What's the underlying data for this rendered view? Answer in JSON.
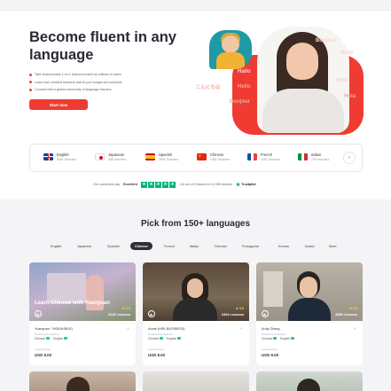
{
  "hero": {
    "title": "Become fluent in any language",
    "bullets": [
      "Take customizable 1-on-1 lessons trusted by millions of users",
      "Learn from certified teachers that fit your budget and schedule",
      "Connect with a global community of language learners"
    ],
    "cta_label": "Start now",
    "greetings": [
      "Bonjour",
      "Hello",
      "Hola",
      "Hallo",
      "Hello",
      "Hola",
      "Bonjour",
      "こんにちは"
    ]
  },
  "languages": [
    {
      "name": "English",
      "count": "9064 Teachers"
    },
    {
      "name": "Japanese",
      "count": "968 Teachers"
    },
    {
      "name": "Spanish",
      "count": "3996 Teachers"
    },
    {
      "name": "Chinese",
      "count": "1984 Teachers"
    },
    {
      "name": "French",
      "count": "1084 Teachers"
    },
    {
      "name": "Italian",
      "count": "798 Teachers"
    }
  ],
  "strip_next_label": "›",
  "trust": {
    "prefix": "Our customers say",
    "rating_word": "Excellent",
    "summary": "4.6 out of 5 based on 13,356 reviews",
    "brand": "Trustpilot"
  },
  "pick": {
    "title": "Pick from 150+ languages",
    "tabs": [
      "English",
      "Japanese",
      "Spanish",
      "Chinese",
      "French",
      "Italian",
      "German",
      "Portuguese",
      "Korean",
      "Arabic",
      "More"
    ],
    "active_tab": "Chinese"
  },
  "teachers": [
    {
      "name": "Yuanyuan（HSK&HSKK)",
      "role": "Professional Teacher",
      "overlay": "Learn Chinese with Yuanyuan",
      "lessons": "2218 Lessons",
      "rating": "★ 5.0",
      "lang1": "Chinese",
      "lang2": "English",
      "price_label": "Lessons from",
      "price": "USD 8.00"
    },
    {
      "name": "Annie (HSK,BUSINESS)",
      "role": "Professional Teacher",
      "overlay": "",
      "lessons": "6404 Lessons",
      "rating": "★ 5.0",
      "lang1": "Chinese",
      "lang2": "English",
      "price_label": "Lessons from",
      "price": "USD 8.00"
    },
    {
      "name": "Andy Zhang",
      "role": "Professional Teacher",
      "overlay": "",
      "lessons": "3650 Lessons",
      "rating": "★ 5.0",
      "lang1": "Chinese",
      "lang2": "English",
      "price_label": "Lessons from",
      "price": "USD 9.00"
    }
  ],
  "colors": {
    "brand_red": "#ef3b32",
    "dark_text": "#2a2a35",
    "trustpilot_green": "#00b67a"
  }
}
